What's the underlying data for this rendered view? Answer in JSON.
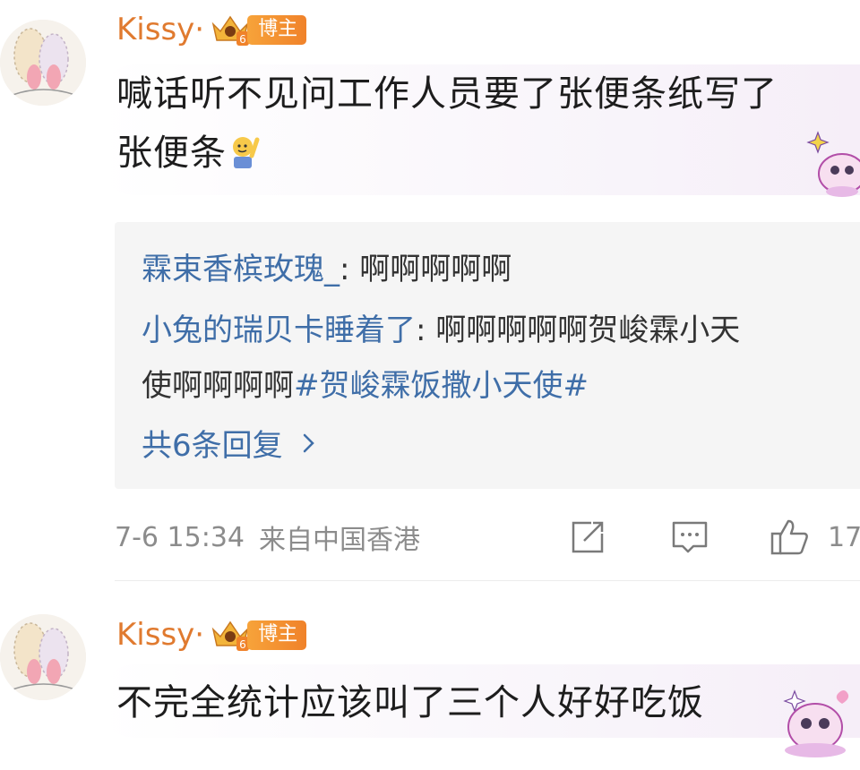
{
  "comments": [
    {
      "username": "Kissy·",
      "level": "6",
      "role_badge": "博主",
      "text_line1": "喊话听不见问工作人员要了张便条纸写了",
      "text_line2": "张便条",
      "replies": [
        {
          "user": "霖束香槟玫瑰_",
          "sep": ": ",
          "text": "啊啊啊啊啊"
        },
        {
          "user": "小兔的瑞贝卡睡着了",
          "sep": ": ",
          "text_line1": "啊啊啊啊啊贺峻霖小天",
          "text_line2": "使啊啊啊啊",
          "hashtag": "#贺峻霖饭撒小天使#"
        }
      ],
      "more_replies": "共6条回复",
      "timestamp": "7-6 15:34",
      "location": "来自中国香港",
      "like_count": "17"
    },
    {
      "username": "Kissy·",
      "level": "6",
      "role_badge": "博主",
      "text_line1": "不完全统计应该叫了三个人好好吃饭"
    }
  ],
  "colors": {
    "username": "#e07a2f",
    "link": "#3f6ea8",
    "meta": "#8c8c8c",
    "reply_bg": "#f5f5f5"
  },
  "icons": {
    "share": "share-icon",
    "comment": "comment-icon",
    "like": "thumbs-up-icon",
    "chevron": "chevron-right-icon"
  }
}
